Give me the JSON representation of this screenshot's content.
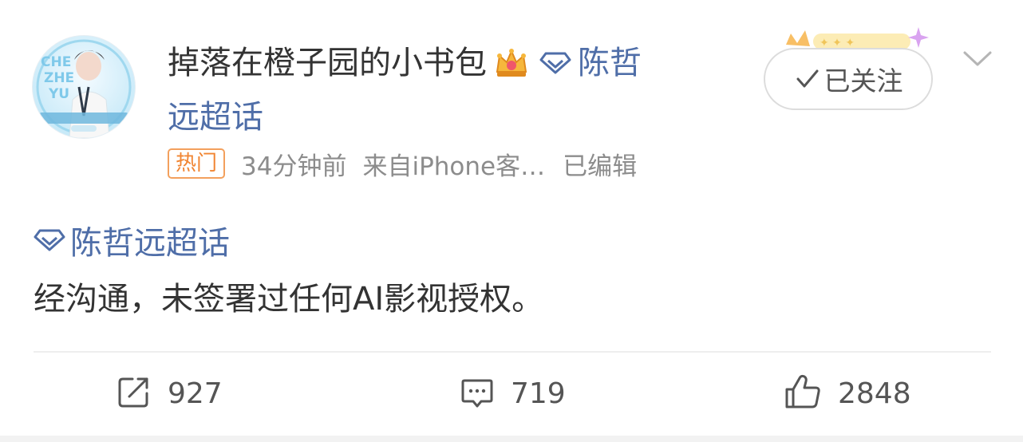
{
  "post": {
    "author": {
      "username": "掉落在橙子园的小书包",
      "avatar_text": "CHE ZHE YU",
      "vip_badge": "crown-icon",
      "supertopic_line1": "陈哲",
      "supertopic_line2": "远超话"
    },
    "meta": {
      "hot_tag": "热门",
      "time": "34分钟前",
      "source": "来自iPhone客…",
      "edited": "已编辑"
    },
    "follow_button": {
      "label": "已关注",
      "icon": "check-icon"
    },
    "topic": "陈哲远超话",
    "body": "经沟通，未签署过任何AI影视授权。",
    "actions": {
      "repost": {
        "icon": "repost-icon",
        "count": "927"
      },
      "comment": {
        "icon": "comment-icon",
        "count": "719"
      },
      "like": {
        "icon": "thumbs-up-icon",
        "count": "2848"
      }
    },
    "colors": {
      "link": "#4f6ea8",
      "hot": "#f18532",
      "text": "#333333",
      "meta": "#8c8c8c"
    }
  }
}
